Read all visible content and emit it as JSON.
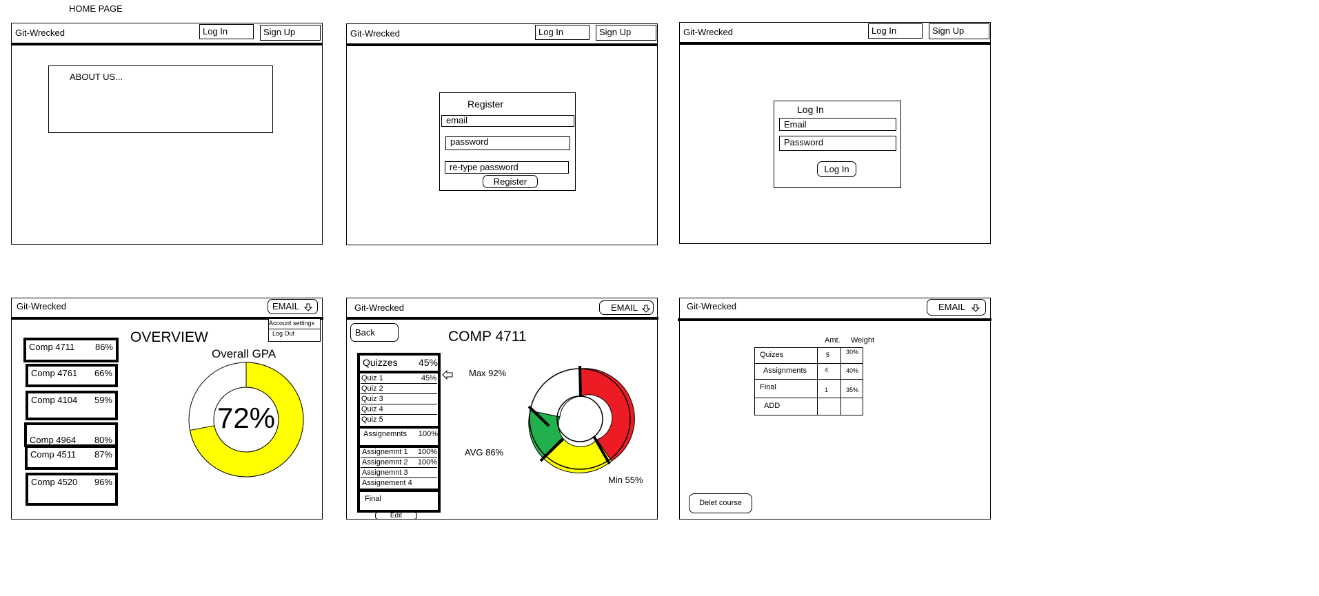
{
  "page_label": "HOME PAGE",
  "brand": "Git-Wrecked",
  "nav": {
    "login": "Log In",
    "signup": "Sign Up",
    "email": "EMAIL"
  },
  "home": {
    "about": "ABOUT US..."
  },
  "register": {
    "title": "Register",
    "email_placeholder": "email",
    "password_placeholder": "password",
    "retype_placeholder": "re-type password",
    "submit": "Register"
  },
  "login": {
    "title": "Log In",
    "email_placeholder": "Email",
    "password_placeholder": "Password",
    "submit": "Log In"
  },
  "overview": {
    "heading": "OVERVIEW",
    "gpa_label": "Overall GPA",
    "gpa_value": "72%",
    "gpa_fraction": 0.72,
    "menu": {
      "account": "Account settings",
      "logout": "Log Out"
    },
    "courses": [
      {
        "name": "Comp 4711",
        "pct": "86%"
      },
      {
        "name": "Comp 4761",
        "pct": "66%"
      },
      {
        "name": "Comp 4104",
        "pct": "59%"
      },
      {
        "name": "Comp 4964",
        "pct": "80%"
      },
      {
        "name": "Comp 4511",
        "pct": "87%"
      },
      {
        "name": "Comp 4520",
        "pct": "96%"
      }
    ],
    "colors": {
      "gpa": "#ffff00"
    }
  },
  "course": {
    "back": "Back",
    "heading": "COMP 4711",
    "quizzes": {
      "label": "Quizzes",
      "pct": "45%"
    },
    "quiz_items": [
      {
        "name": "Quiz 1",
        "pct": "45%"
      },
      {
        "name": "Quiz 2",
        "pct": ""
      },
      {
        "name": "Quiz 3",
        "pct": ""
      },
      {
        "name": "Quiz 4",
        "pct": ""
      },
      {
        "name": "Quiz 5",
        "pct": ""
      }
    ],
    "assignments": {
      "label": "Assignemnts",
      "pct": "100%"
    },
    "assignment_items": [
      {
        "name": "Assignemnt 1",
        "pct": "100%"
      },
      {
        "name": "Assignemnt 2",
        "pct": "100%"
      },
      {
        "name": "Assignemnt 3",
        "pct": ""
      },
      {
        "name": "Assignement 4",
        "pct": ""
      }
    ],
    "final": "Final",
    "edit": "Edit",
    "stats": {
      "max": "Max 92%",
      "avg": "AVG 86%",
      "min": "Min 55%"
    },
    "colors": {
      "red": "#ed1c24",
      "green": "#22b14c",
      "yellow": "#ffff00"
    }
  },
  "settings": {
    "col_amt": "Amt.",
    "col_weight": "Weight",
    "rows": [
      {
        "label": "Quizes",
        "amt": "5",
        "weight": "30%"
      },
      {
        "label": "Assignments",
        "amt": "4",
        "weight": "40%"
      },
      {
        "label": "Final",
        "amt": "1",
        "weight": "35%"
      },
      {
        "label": "ADD",
        "amt": "",
        "weight": ""
      }
    ],
    "delete": "Delet course"
  }
}
